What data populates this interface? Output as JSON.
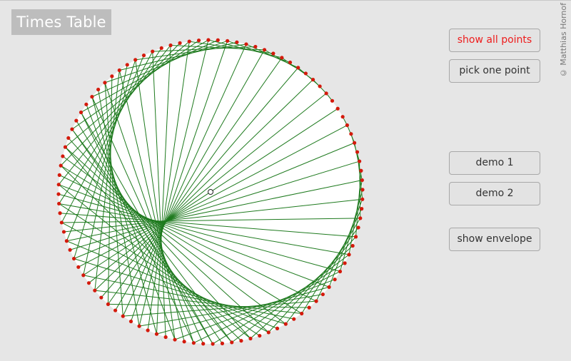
{
  "title": "Times Table",
  "copyright": "© Matthias Hornof",
  "buttons": {
    "show_all_points": "show all points",
    "pick_one_point": "pick one point",
    "demo1": "demo 1",
    "demo2": "demo 2",
    "show_envelope": "show envelope"
  },
  "times_table": {
    "points": 100,
    "multiplier": 2,
    "line_color": "#1e7a1e",
    "point_color": "#d41a0c",
    "circle_fill": "#ffffff"
  },
  "colors": {
    "background": "#e6e6e6",
    "title_bg": "#bdbdbd",
    "accent_red": "#ee1c1c"
  }
}
